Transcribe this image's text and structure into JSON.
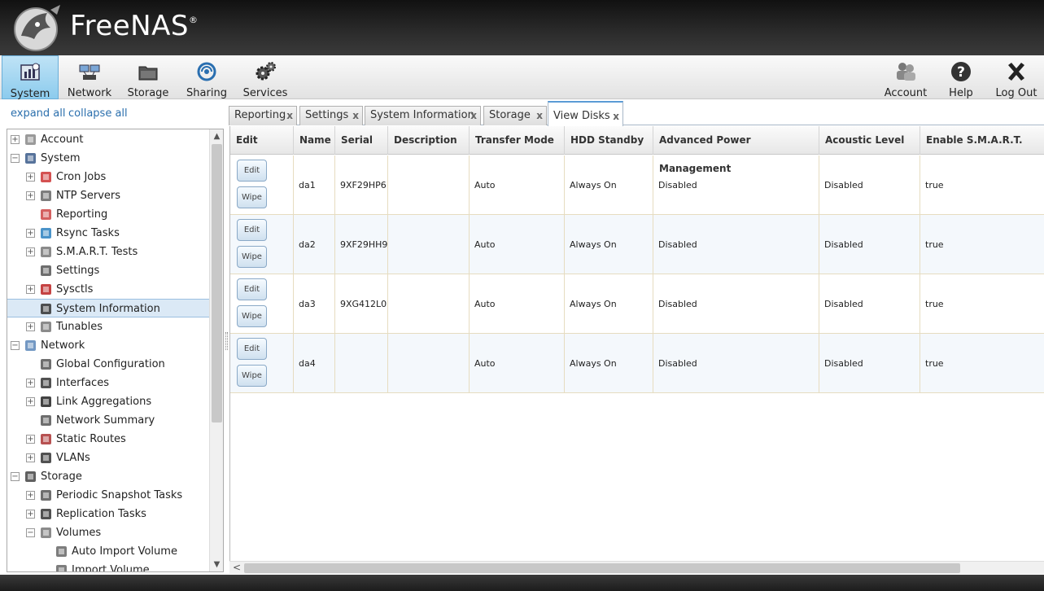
{
  "app": {
    "brand": "FreeNAS",
    "trademark": "®"
  },
  "toolbar": {
    "system": "System",
    "network": "Network",
    "storage": "Storage",
    "sharing": "Sharing",
    "services": "Services",
    "account": "Account",
    "help": "Help",
    "logout": "Log Out"
  },
  "tree_controls": {
    "expand_all": "expand all",
    "collapse_all": "collapse all"
  },
  "tree": [
    {
      "label": "Account",
      "icon": "users-icon",
      "expander": "+"
    },
    {
      "label": "System",
      "icon": "system-icon",
      "expander": "−"
    },
    {
      "label": "Cron Jobs",
      "icon": "calendar-icon",
      "expander": "+"
    },
    {
      "label": "NTP Servers",
      "icon": "clock-icon",
      "expander": "+"
    },
    {
      "label": "Reporting",
      "icon": "chart-icon",
      "expander": ""
    },
    {
      "label": "Rsync Tasks",
      "icon": "sync-icon",
      "expander": "+"
    },
    {
      "label": "S.M.A.R.T. Tests",
      "icon": "disk-test-icon",
      "expander": "+"
    },
    {
      "label": "Settings",
      "icon": "wrench-icon",
      "expander": ""
    },
    {
      "label": "Sysctls",
      "icon": "sysctl-icon",
      "expander": "+"
    },
    {
      "label": "System Information",
      "icon": "info-icon",
      "expander": ""
    },
    {
      "label": "Tunables",
      "icon": "tunables-icon",
      "expander": "+"
    },
    {
      "label": "Network",
      "icon": "network-icon",
      "expander": "−"
    },
    {
      "label": "Global Configuration",
      "icon": "wrench-icon",
      "expander": ""
    },
    {
      "label": "Interfaces",
      "icon": "interface-icon",
      "expander": "+"
    },
    {
      "label": "Link Aggregations",
      "icon": "link-aggregation-icon",
      "expander": "+"
    },
    {
      "label": "Network Summary",
      "icon": "wrench-icon",
      "expander": ""
    },
    {
      "label": "Static Routes",
      "icon": "routes-icon",
      "expander": "+"
    },
    {
      "label": "VLANs",
      "icon": "vlan-icon",
      "expander": "+"
    },
    {
      "label": "Storage",
      "icon": "folder-icon",
      "expander": "−"
    },
    {
      "label": "Periodic Snapshot Tasks",
      "icon": "snapshot-icon",
      "expander": "+"
    },
    {
      "label": "Replication Tasks",
      "icon": "replication-icon",
      "expander": "+"
    },
    {
      "label": "Volumes",
      "icon": "volumes-icon",
      "expander": "−"
    },
    {
      "label": "Auto Import Volume",
      "icon": "import-icon",
      "expander": ""
    },
    {
      "label": "Import Volume",
      "icon": "import-icon",
      "expander": ""
    }
  ],
  "tabs": [
    "Reporting",
    "Settings",
    "System Information",
    "Storage",
    "View Disks"
  ],
  "grid": {
    "columns": [
      "Edit",
      "Name",
      "Serial",
      "Description",
      "Transfer Mode",
      "HDD Standby",
      "Advanced Power Management",
      "Acoustic Level",
      "Enable S.M.A.R.T."
    ],
    "edit_label": "Edit",
    "wipe_label": "Wipe",
    "rows": [
      {
        "name": "da1",
        "serial": "9XF29HP6",
        "description": "",
        "transfer_mode": "Auto",
        "hdd_standby": "Always On",
        "apm": "Disabled",
        "acoustic": "Disabled",
        "smart": "true"
      },
      {
        "name": "da2",
        "serial": "9XF29HH9",
        "description": "",
        "transfer_mode": "Auto",
        "hdd_standby": "Always On",
        "apm": "Disabled",
        "acoustic": "Disabled",
        "smart": "true"
      },
      {
        "name": "da3",
        "serial": "9XG412L0",
        "description": "",
        "transfer_mode": "Auto",
        "hdd_standby": "Always On",
        "apm": "Disabled",
        "acoustic": "Disabled",
        "smart": "true"
      },
      {
        "name": "da4",
        "serial": "",
        "description": "",
        "transfer_mode": "Auto",
        "hdd_standby": "Always On",
        "apm": "Disabled",
        "acoustic": "Disabled",
        "smart": "true"
      }
    ]
  }
}
